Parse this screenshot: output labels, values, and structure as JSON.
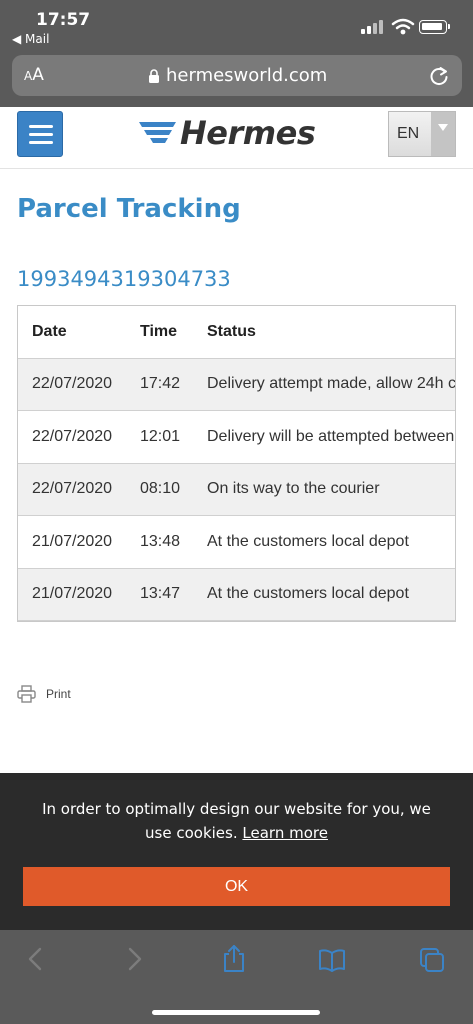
{
  "status_bar": {
    "time": "17:57",
    "back_app": "◀ Mail"
  },
  "browser": {
    "aa_small": "A",
    "aa_large": "A",
    "url": "hermesworld.com"
  },
  "header": {
    "logo_text": "Hermes",
    "language": "EN"
  },
  "page": {
    "title": "Parcel Tracking",
    "tracking_number": "1993494319304733",
    "columns": [
      "Date",
      "Time",
      "Status"
    ],
    "rows": [
      {
        "date": "22/07/2020",
        "time": "17:42",
        "status": "Delivery attempt made, allow 24h c"
      },
      {
        "date": "22/07/2020",
        "time": "12:01",
        "status": "Delivery will be attempted between"
      },
      {
        "date": "22/07/2020",
        "time": "08:10",
        "status": "On its way to the courier"
      },
      {
        "date": "21/07/2020",
        "time": "13:48",
        "status": "At the customers local depot"
      },
      {
        "date": "21/07/2020",
        "time": "13:47",
        "status": "At the customers local depot"
      }
    ],
    "print_label": "Print"
  },
  "cookie": {
    "text": "In order to optimally design our website for you, we use cookies.",
    "link": "Learn more",
    "ok": "OK"
  },
  "colors": {
    "brand_blue": "#3a8cc6",
    "accent_orange": "#e05a2a",
    "toolbar_blue": "#3b83c6"
  }
}
